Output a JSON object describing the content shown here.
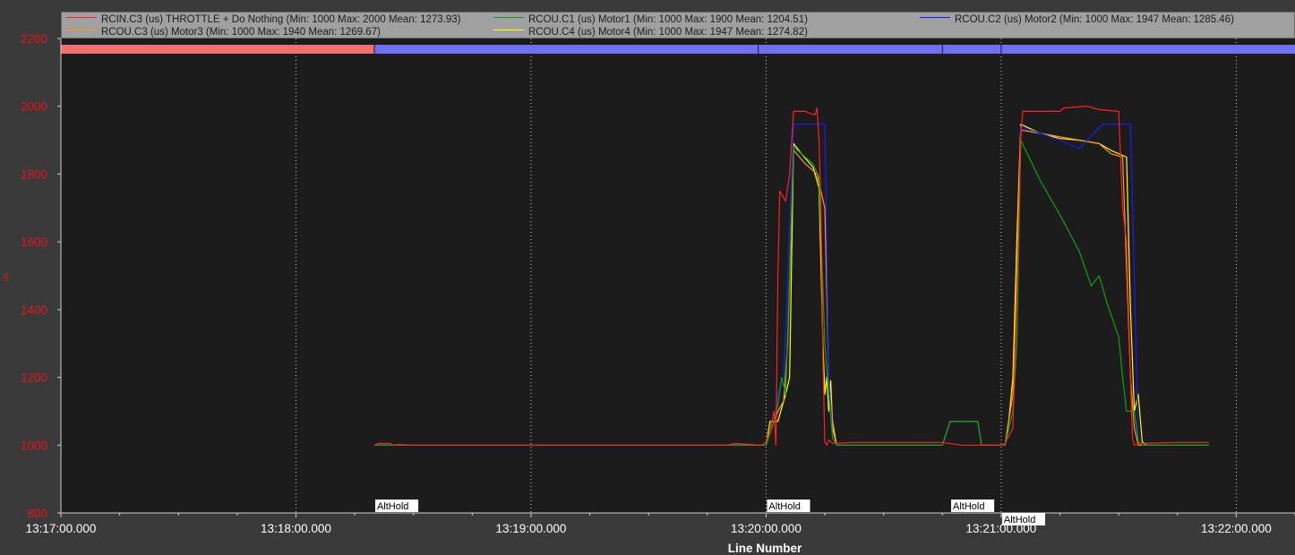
{
  "chart_data": {
    "type": "line",
    "xlabel": "Line Number",
    "ylabel": "us",
    "ylim": [
      800,
      2200
    ],
    "yticks": [
      800,
      1000,
      1200,
      1400,
      1600,
      1800,
      2000,
      2200
    ],
    "xlim": [
      "13:17:00.000",
      "13:22:15.000"
    ],
    "xticks": [
      "13:17:00.000",
      "13:18:00.000",
      "13:19:00.000",
      "13:20:00.000",
      "13:21:00.000",
      "13:22:00.000"
    ],
    "grid": true,
    "legend_position": "top",
    "series": [
      {
        "name": "RCIN.C3 (us) THROTTLE + Do Nothing (Min: 1000 Max: 2000 Mean: 1273.93)",
        "color": "#ff2020",
        "points": [
          [
            "13:18:20.0",
            1000
          ],
          [
            "13:18:21.0",
            1005
          ],
          [
            "13:18:24.0",
            1005
          ],
          [
            "13:18:25.0",
            1000
          ],
          [
            "13:18:26.0",
            1002
          ],
          [
            "13:18:30.0",
            1000
          ],
          [
            "13:19:50.0",
            1000
          ],
          [
            "13:19:52.0",
            1005
          ],
          [
            "13:19:59.0",
            1000
          ],
          [
            "13:20:00.0",
            1010
          ],
          [
            "13:20:01.0",
            1040
          ],
          [
            "13:20:02.0",
            1100
          ],
          [
            "13:20:02.5",
            1000
          ],
          [
            "13:20:03.0",
            1500
          ],
          [
            "13:20:03.5",
            1750
          ],
          [
            "13:20:05.0",
            1720
          ],
          [
            "13:20:06.0",
            1800
          ],
          [
            "13:20:07.0",
            1985
          ],
          [
            "13:20:10.0",
            1985
          ],
          [
            "13:20:11.0",
            1980
          ],
          [
            "13:20:12.5",
            1975
          ],
          [
            "13:20:13.0",
            1995
          ],
          [
            "13:20:13.5",
            1900
          ],
          [
            "13:20:14.0",
            1700
          ],
          [
            "13:20:14.5",
            1250
          ],
          [
            "13:20:15.0",
            1010
          ],
          [
            "13:20:15.5",
            1000
          ],
          [
            "13:20:16.0",
            1015
          ],
          [
            "13:20:17.0",
            1005
          ],
          [
            "13:20:22.0",
            1008
          ],
          [
            "13:20:45.0",
            1008
          ],
          [
            "13:20:50.0",
            1000
          ],
          [
            "13:21:00.0",
            1000
          ],
          [
            "13:21:01.0",
            1005
          ],
          [
            "13:21:03.0",
            1050
          ],
          [
            "13:21:04.0",
            1450
          ],
          [
            "13:21:05.0",
            1900
          ],
          [
            "13:21:05.5",
            1985
          ],
          [
            "13:21:15.0",
            1985
          ],
          [
            "13:21:16.0",
            1995
          ],
          [
            "13:21:22.0",
            2000
          ],
          [
            "13:21:25.0",
            1990
          ],
          [
            "13:21:30.0",
            1985
          ],
          [
            "13:21:31.0",
            1700
          ],
          [
            "13:21:32.0",
            1600
          ],
          [
            "13:21:33.0",
            1200
          ],
          [
            "13:21:33.5",
            1020
          ],
          [
            "13:21:34.0",
            1000
          ],
          [
            "13:21:35.0",
            1005
          ],
          [
            "13:21:45.0",
            1008
          ],
          [
            "13:21:53.0",
            1008
          ]
        ]
      },
      {
        "name": "RCOU.C1 (us) Motor1 (Min: 1000 Max: 1900 Mean: 1204.51)",
        "color": "#12a012",
        "points": [
          [
            "13:18:20.0",
            1000
          ],
          [
            "13:20:00.0",
            1000
          ],
          [
            "13:20:02.0",
            1070
          ],
          [
            "13:20:03.0",
            1120
          ],
          [
            "13:20:04.0",
            1200
          ],
          [
            "13:20:05.0",
            1150
          ],
          [
            "13:20:07.0",
            1880
          ],
          [
            "13:20:09.0",
            1860
          ],
          [
            "13:20:12.0",
            1830
          ],
          [
            "13:20:13.5",
            1790
          ],
          [
            "13:20:15.0",
            1300
          ],
          [
            "13:20:16.0",
            1150
          ],
          [
            "13:20:17.0",
            1020
          ],
          [
            "13:20:18.0",
            1000
          ],
          [
            "13:20:45.0",
            1000
          ],
          [
            "13:20:47.0",
            1070
          ],
          [
            "13:20:54.0",
            1070
          ],
          [
            "13:20:55.0",
            1000
          ],
          [
            "13:21:01.0",
            1000
          ],
          [
            "13:21:03.0",
            1100
          ],
          [
            "13:21:04.0",
            1300
          ],
          [
            "13:21:05.0",
            1900
          ],
          [
            "13:21:10.0",
            1780
          ],
          [
            "13:21:15.0",
            1680
          ],
          [
            "13:21:20.0",
            1570
          ],
          [
            "13:21:23.0",
            1470
          ],
          [
            "13:21:25.0",
            1500
          ],
          [
            "13:21:27.0",
            1420
          ],
          [
            "13:21:30.0",
            1320
          ],
          [
            "13:21:31.0",
            1200
          ],
          [
            "13:21:32.0",
            1100
          ],
          [
            "13:21:34.0",
            1100
          ],
          [
            "13:21:35.0",
            1010
          ],
          [
            "13:21:36.0",
            1000
          ],
          [
            "13:21:53.0",
            1000
          ]
        ]
      },
      {
        "name": "RCOU.C2 (us) Motor2 (Min: 1000 Max: 1947 Mean: 1285.46)",
        "color": "#1a1aff",
        "points": [
          [
            "13:18:20.0",
            1000
          ],
          [
            "13:20:00.0",
            1000
          ],
          [
            "13:20:02.0",
            1070
          ],
          [
            "13:20:03.0",
            1150
          ],
          [
            "13:20:04.5",
            1200
          ],
          [
            "13:20:05.5",
            1500
          ],
          [
            "13:20:07.0",
            1947
          ],
          [
            "13:20:15.0",
            1947
          ],
          [
            "13:20:16.0",
            1200
          ],
          [
            "13:20:17.0",
            1020
          ],
          [
            "13:20:18.0",
            1000
          ],
          [
            "13:20:45.0",
            1000
          ],
          [
            "13:20:47.0",
            1070
          ],
          [
            "13:20:54.0",
            1070
          ],
          [
            "13:20:55.0",
            1000
          ],
          [
            "13:21:01.0",
            1000
          ],
          [
            "13:21:03.0",
            1100
          ],
          [
            "13:21:04.0",
            1300
          ],
          [
            "13:21:05.0",
            1940
          ],
          [
            "13:21:10.0",
            1920
          ],
          [
            "13:21:15.0",
            1900
          ],
          [
            "13:21:20.0",
            1875
          ],
          [
            "13:21:22.0",
            1900
          ],
          [
            "13:21:26.0",
            1947
          ],
          [
            "13:21:33.0",
            1947
          ],
          [
            "13:21:34.0",
            1500
          ],
          [
            "13:21:35.0",
            1010
          ],
          [
            "13:21:36.0",
            1000
          ],
          [
            "13:21:53.0",
            1000
          ]
        ]
      },
      {
        "name": "RCOU.C3 (us) Motor3 (Min: 1000 Max: 1940 Mean: 1269.67)",
        "color": "#ff9a1e",
        "points": [
          [
            "13:18:20.0",
            1000
          ],
          [
            "13:20:00.0",
            1000
          ],
          [
            "13:20:02.0",
            1070
          ],
          [
            "13:20:03.0",
            1100
          ],
          [
            "13:20:04.5",
            1130
          ],
          [
            "13:20:05.5",
            1300
          ],
          [
            "13:20:07.0",
            1870
          ],
          [
            "13:20:10.0",
            1830
          ],
          [
            "13:20:13.0",
            1800
          ],
          [
            "13:20:15.0",
            1700
          ],
          [
            "13:20:16.0",
            1200
          ],
          [
            "13:20:17.0",
            1070
          ],
          [
            "13:20:18.0",
            1000
          ],
          [
            "13:20:45.0",
            1000
          ],
          [
            "13:20:47.0",
            1070
          ],
          [
            "13:20:54.0",
            1070
          ],
          [
            "13:20:55.0",
            1000
          ],
          [
            "13:21:01.0",
            1000
          ],
          [
            "13:21:03.0",
            1150
          ],
          [
            "13:21:04.0",
            1500
          ],
          [
            "13:21:05.0",
            1930
          ],
          [
            "13:21:10.0",
            1920
          ],
          [
            "13:21:15.0",
            1910
          ],
          [
            "13:21:20.0",
            1900
          ],
          [
            "13:21:25.0",
            1890
          ],
          [
            "13:21:28.0",
            1860
          ],
          [
            "13:21:31.0",
            1850
          ],
          [
            "13:21:33.0",
            1200
          ],
          [
            "13:21:34.0",
            1050
          ],
          [
            "13:21:35.0",
            1000
          ],
          [
            "13:21:53.0",
            1000
          ]
        ]
      },
      {
        "name": "RCOU.C4 (us) Motor4 (Min: 1000 Max: 1947 Mean: 1274.82)",
        "color": "#ffff00",
        "points": [
          [
            "13:18:20.0",
            1000
          ],
          [
            "13:20:00.0",
            1000
          ],
          [
            "13:20:01.0",
            1070
          ],
          [
            "13:20:03.0",
            1070
          ],
          [
            "13:20:04.0",
            1110
          ],
          [
            "13:20:05.0",
            1150
          ],
          [
            "13:20:06.0",
            1200
          ],
          [
            "13:20:07.0",
            1890
          ],
          [
            "13:20:09.0",
            1860
          ],
          [
            "13:20:12.0",
            1820
          ],
          [
            "13:20:13.5",
            1760
          ],
          [
            "13:20:14.5",
            1300
          ],
          [
            "13:20:15.0",
            1150
          ],
          [
            "13:20:15.5",
            1200
          ],
          [
            "13:20:16.0",
            1100
          ],
          [
            "13:20:16.5",
            1190
          ],
          [
            "13:20:17.0",
            1050
          ],
          [
            "13:20:18.0",
            1000
          ],
          [
            "13:20:45.0",
            1000
          ],
          [
            "13:20:47.0",
            1070
          ],
          [
            "13:20:54.0",
            1070
          ],
          [
            "13:20:55.0",
            1000
          ],
          [
            "13:21:01.0",
            1000
          ],
          [
            "13:21:02.0",
            1080
          ],
          [
            "13:21:03.0",
            1200
          ],
          [
            "13:21:04.0",
            1600
          ],
          [
            "13:21:05.0",
            1947
          ],
          [
            "13:21:10.0",
            1920
          ],
          [
            "13:21:15.0",
            1905
          ],
          [
            "13:21:20.0",
            1900
          ],
          [
            "13:21:25.0",
            1890
          ],
          [
            "13:21:28.0",
            1870
          ],
          [
            "13:21:32.0",
            1850
          ],
          [
            "13:21:33.0",
            1400
          ],
          [
            "13:21:34.0",
            1100
          ],
          [
            "13:21:35.0",
            1150
          ],
          [
            "13:21:36.0",
            1010
          ],
          [
            "13:21:37.0",
            1000
          ],
          [
            "13:21:53.0",
            1000
          ]
        ]
      }
    ],
    "mode_markers": [
      {
        "time": "13:18:20.000",
        "label": "AltHold"
      },
      {
        "time": "13:20:00.000",
        "label": "AltHold"
      },
      {
        "time": "13:20:47.000",
        "label": "AltHold"
      },
      {
        "time": "13:21:00.000",
        "label": "AltHold"
      }
    ],
    "mode_bar": [
      {
        "from": "13:17:00.000",
        "to": "13:18:20.000",
        "color": "#f07070"
      },
      {
        "from": "13:18:20.000",
        "to": "13:22:15.000",
        "color": "#7070f0"
      }
    ],
    "mode_dividers": [
      "13:18:20.000",
      "13:19:58.000",
      "13:20:45.000",
      "13:21:00.000"
    ]
  }
}
